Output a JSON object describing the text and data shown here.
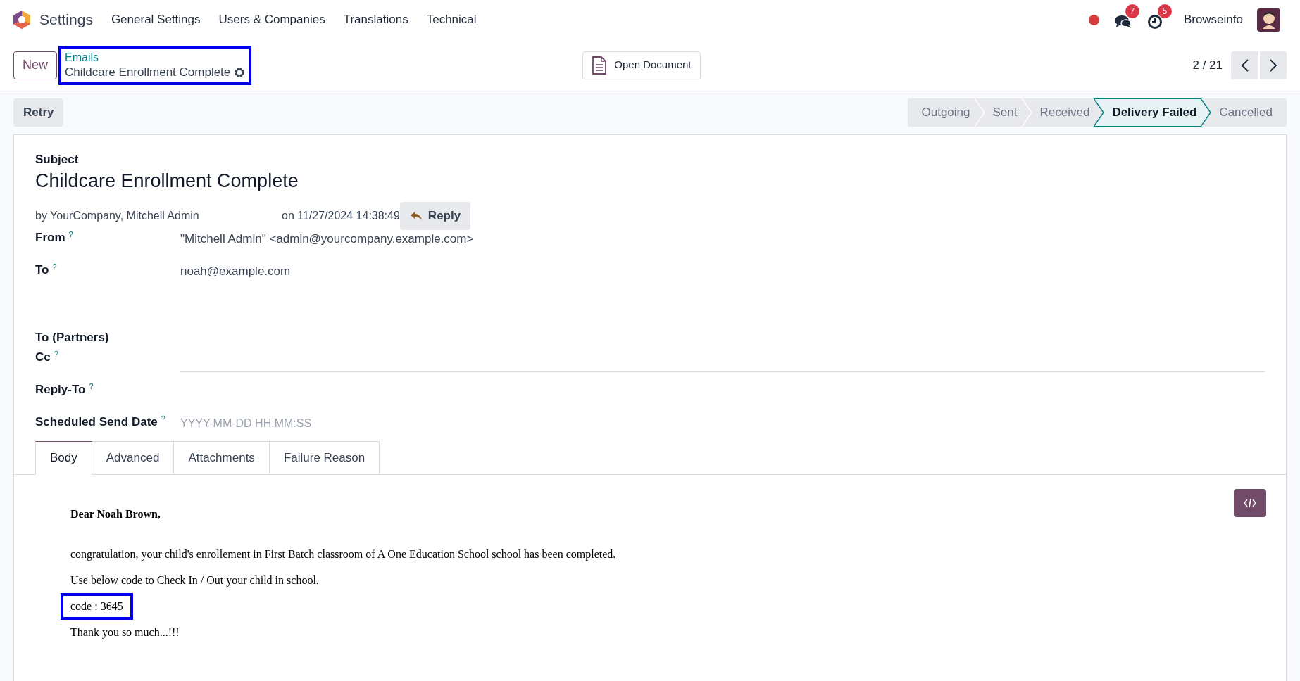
{
  "navbar": {
    "app": "Settings",
    "menus": [
      "General Settings",
      "Users & Companies",
      "Translations",
      "Technical"
    ],
    "messages_count": "7",
    "activities_count": "5",
    "company": "Browseinfo"
  },
  "control_panel": {
    "new_button": "New",
    "breadcrumb": {
      "parent": "Emails",
      "current": "Childcare Enrollment Complete",
      "highlighted": true
    },
    "open_document": "Open Document",
    "pager": "2 / 21"
  },
  "action_button": "Retry",
  "stages": [
    {
      "label": "Outgoing",
      "selected": false
    },
    {
      "label": "Sent",
      "selected": false
    },
    {
      "label": "Received",
      "selected": false
    },
    {
      "label": "Delivery Failed",
      "selected": true
    },
    {
      "label": "Cancelled",
      "selected": false
    }
  ],
  "form": {
    "subject_label": "Subject",
    "subject": "Childcare Enrollment Complete",
    "author": "by YourCompany, Mitchell Admin",
    "date": "on 11/27/2024 14:38:49",
    "reply_button": "Reply",
    "fields": [
      {
        "kind": "text",
        "label": "From",
        "help": "?",
        "value": "\"Mitchell Admin\" <admin@yourcompany.example.com>"
      },
      {
        "kind": "text",
        "label": "To",
        "help": "?",
        "value": "noah@example.com"
      },
      {
        "kind": "empty",
        "label": "To (Partners)"
      },
      {
        "kind": "input",
        "label": "Cc",
        "help": "?"
      },
      {
        "kind": "empty",
        "label": "Reply-To",
        "help": "?"
      },
      {
        "kind": "input",
        "label": "Scheduled Send Date",
        "help": "?",
        "placeholder": "YYYY-MM-DD HH:MM:SS"
      }
    ]
  },
  "tabs": [
    {
      "label": "Body",
      "selected": true
    },
    {
      "label": "Advanced",
      "selected": false
    },
    {
      "label": "Attachments",
      "selected": false
    },
    {
      "label": "Failure Reason",
      "selected": false
    }
  ],
  "body": [
    {
      "kind": "greeting",
      "text": "Dear Noah Brown,",
      "highlighted": false
    },
    {
      "kind": "paragraph",
      "text": "congratulation, your child's enrollement in First Batch classroom of A One Education School school has been completed.",
      "highlighted": false
    },
    {
      "kind": "paragraph",
      "text": "Use below code to Check In / Out your child in school.",
      "highlighted": false
    },
    {
      "kind": "paragraph",
      "text": "code : 3645",
      "highlighted": true
    },
    {
      "kind": "paragraph",
      "text": "Thank you so much...!!!",
      "highlighted": false
    }
  ]
}
